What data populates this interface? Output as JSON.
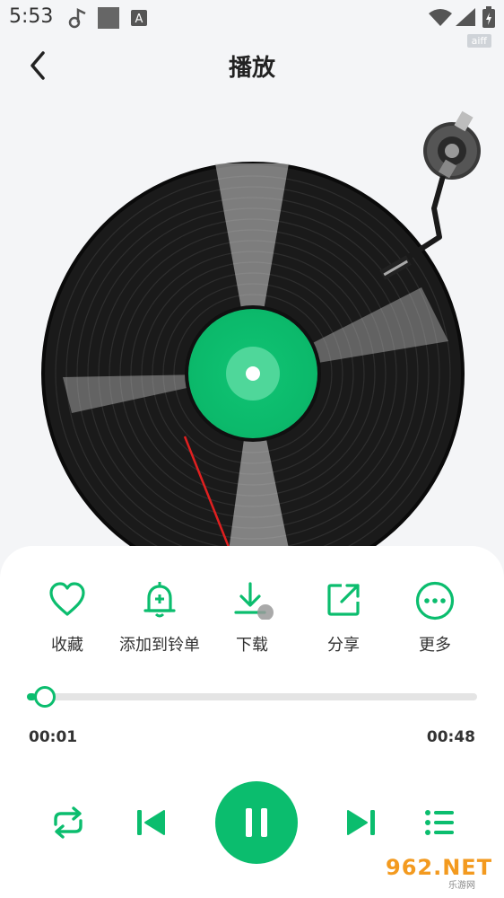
{
  "status_bar": {
    "time": "5:53",
    "icons": [
      "music-note-icon",
      "gray-square-icon",
      "a-badge-icon",
      "wifi-icon",
      "signal-icon",
      "battery-charging-icon"
    ],
    "badge": "aiff"
  },
  "header": {
    "title": "播放",
    "back_icon": "chevron-left-icon"
  },
  "actions": [
    {
      "label": "收藏",
      "icon": "heart-icon"
    },
    {
      "label": "添加到铃单",
      "icon": "bell-plus-icon"
    },
    {
      "label": "下载",
      "icon": "download-icon"
    },
    {
      "label": "分享",
      "icon": "share-icon"
    },
    {
      "label": "更多",
      "icon": "more-icon"
    }
  ],
  "progress": {
    "current": "00:01",
    "total": "00:48",
    "fraction": 0.02
  },
  "controls": {
    "repeat_icon": "repeat-icon",
    "prev_icon": "skip-previous-icon",
    "play_pause_icon": "pause-icon",
    "next_icon": "skip-next-icon",
    "playlist_icon": "playlist-icon"
  },
  "watermark": {
    "main": "962.NET",
    "sub": "乐游网"
  },
  "colors": {
    "accent": "#0bbd6e",
    "annotation": "#e02020"
  }
}
